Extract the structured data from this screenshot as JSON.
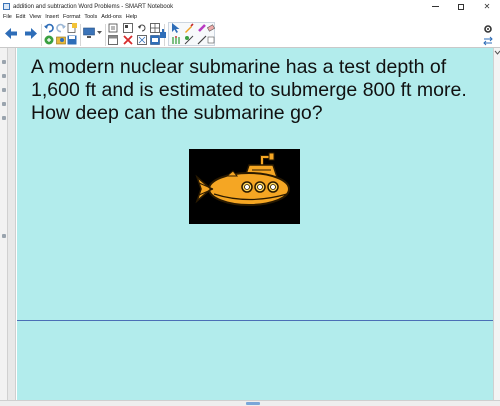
{
  "window": {
    "title": "addition and subtraction Word Problems - SMART Notebook",
    "controls": [
      "minimize",
      "maximize",
      "close"
    ]
  },
  "menu": [
    "File",
    "Edit",
    "View",
    "Insert",
    "Format",
    "Tools",
    "Add-ons",
    "Help"
  ],
  "toolbar": {
    "buttons": [
      "previous-page",
      "next-page",
      "undo",
      "redo",
      "delete",
      "new-page",
      "open",
      "save",
      "paste",
      "screen-shade",
      "fullscreen",
      "dual-display",
      "document-camera",
      "table",
      "select",
      "pens",
      "eraser",
      "lines",
      "shapes",
      "fill",
      "text",
      "settings"
    ],
    "accent": "#3a73b8"
  },
  "page": {
    "background": "#b2ecec",
    "question": "A modern nuclear submarine has a test depth of 1,600 ft and is estimated to submerge 800 ft more. How deep can the submarine go?",
    "image": "submarine-image"
  },
  "colors": {
    "submarine_body": "#f5a623",
    "submarine_outline": "#2a1a00",
    "image_background": "#000000"
  }
}
